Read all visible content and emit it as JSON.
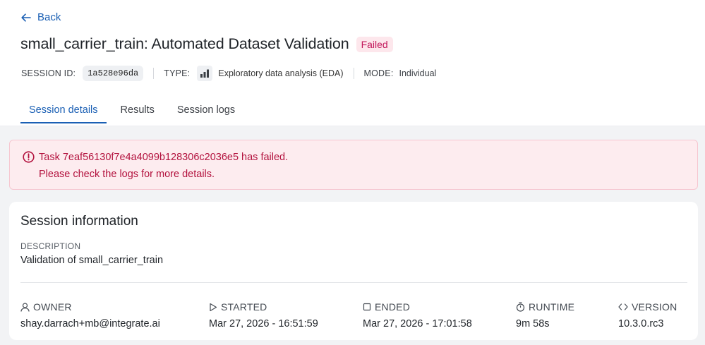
{
  "nav": {
    "back_label": "Back"
  },
  "header": {
    "title": "small_carrier_train: Automated Dataset Validation",
    "status": "Failed",
    "status_color": "#c2185b"
  },
  "meta": {
    "session_id_label": "SESSION ID:",
    "session_id": "1a528e96da",
    "type_label": "TYPE:",
    "type_icon": "bar-chart-icon",
    "type_value": "Exploratory data analysis (EDA)",
    "mode_label": "MODE:",
    "mode_value": "Individual"
  },
  "tabs": [
    {
      "label": "Session details",
      "active": true
    },
    {
      "label": "Results",
      "active": false
    },
    {
      "label": "Session logs",
      "active": false
    }
  ],
  "alert": {
    "icon": "alert-circle-icon",
    "line1": "Task 7eaf56130f7e4a4099b128306c2036e5 has failed.",
    "line2": "Please check the logs for more details.",
    "color": "#b3123e"
  },
  "session_info": {
    "title": "Session information",
    "description_label": "DESCRIPTION",
    "description": "Validation of small_carrier_train",
    "fields": [
      {
        "icon": "user-icon",
        "label": "OWNER",
        "value": "shay.darrach+mb@integrate.ai"
      },
      {
        "icon": "play-icon",
        "label": "STARTED",
        "value": "Mar 27, 2026 - 16:51:59"
      },
      {
        "icon": "stop-icon",
        "label": "ENDED",
        "value": "Mar 27, 2026 - 17:01:58"
      },
      {
        "icon": "stopwatch-icon",
        "label": "RUNTIME",
        "value": "9m 58s"
      },
      {
        "icon": "code-icon",
        "label": "VERSION",
        "value": "10.3.0.rc3"
      }
    ]
  },
  "colors": {
    "accent": "#1a5fb4",
    "background": "#f2f3f5"
  }
}
